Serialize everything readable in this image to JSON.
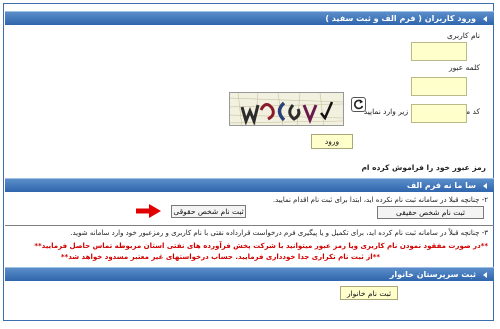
{
  "login": {
    "title": "ورود کاربران ( فرم الف و ثبت سفید )",
    "username_label": "نام کاربری",
    "username_value": "",
    "password_label": "کلمه عبور",
    "password_value": "",
    "captcha_label": "کد مقابل را در قسمت زیر وارد نمایید",
    "captcha_value": "",
    "login_button": "ورود",
    "forgot_link": "رمز عبور خود را فراموش کرده ام"
  },
  "form_a": {
    "title": "سا ما نه فرم الف",
    "step2_text": "۲- چنانچه قبلا در سامانه ثبت نام نکرده اید، ابتدا برای ثبت نام اقدام نمایید.",
    "legal_button": "ثبت نام شخص حقوقی",
    "natural_button": "ثبت نام شخص حقیقی",
    "step3_text": "۳- چنانچه قبلاً در سامانه ثبت نام کرده اید، برای تکمیل و یا پیگیری فرم درخواست قرارداده نقتی با نام کاربری و رمزعبور خود وارد سامانه شوید.",
    "warning1": "**در صورت مفقود نمودن نام کاربری ویا رمز عبور میتوانید با شرکت پخش فرآورده های نفتی استان مربوطه تماس حاصل فرمایید**",
    "warning2": "**از ثبت نام تکراری جدا خودداری فرمایید. حساب درخواستهای غیر معتبر مسدود خواهد شد**"
  },
  "family": {
    "title": "ثبت سرپرستان خانوار",
    "button": "ثبت نام خانوار"
  },
  "colors": {
    "band": "#2f65ad",
    "input_bg": "#ffffcc",
    "warning": "#d10000",
    "arrow": "#e00000"
  }
}
